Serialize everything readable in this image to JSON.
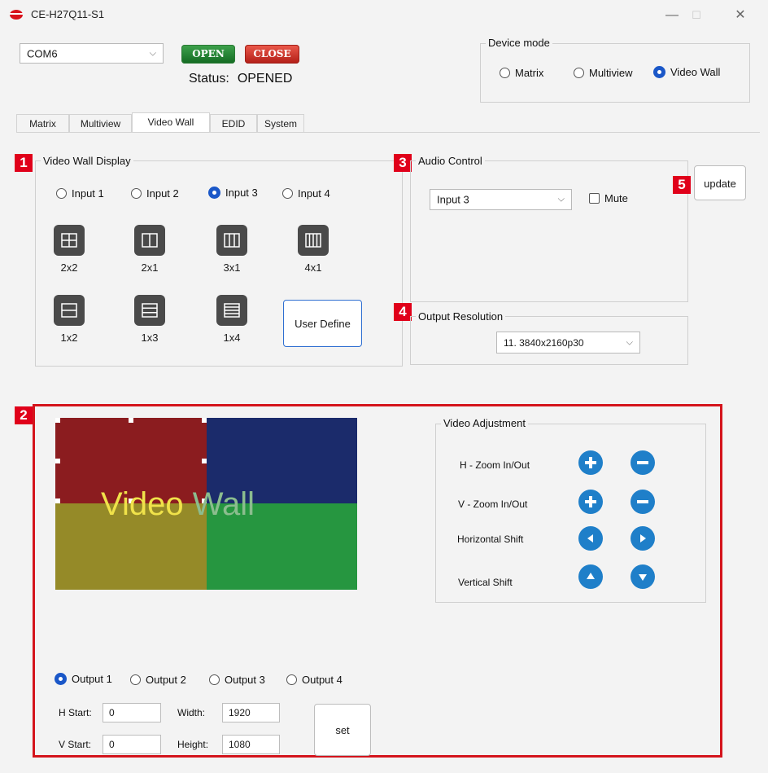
{
  "window": {
    "title": "CE-H27Q11-S1",
    "minimize_glyph": "—",
    "maximize_glyph": "☐",
    "close_glyph": "✕"
  },
  "connection": {
    "port_value": "COM6",
    "open_label": "OPEN",
    "close_label": "CLOSE",
    "status_label": "Status:",
    "status_value": "OPENED"
  },
  "device_mode": {
    "label": "Device mode",
    "options": [
      "Matrix",
      "Multiview",
      "Video Wall"
    ],
    "selected": "Video Wall"
  },
  "tabs": [
    "Matrix",
    "Multiview",
    "Video Wall",
    "EDID",
    "System"
  ],
  "active_tab": "Video Wall",
  "badges": [
    "1",
    "2",
    "3",
    "4",
    "5"
  ],
  "video_wall_display": {
    "label": "Video Wall Display",
    "inputs": [
      "Input 1",
      "Input 2",
      "Input 3",
      "Input 4"
    ],
    "selected_input": "Input 3",
    "layouts": [
      "2x2",
      "2x1",
      "3x1",
      "4x1",
      "1x2",
      "1x3",
      "1x4"
    ],
    "user_define_label": "User Define"
  },
  "audio_control": {
    "label": "Audio Control",
    "source_value": "Input 3",
    "mute_label": "Mute",
    "mute_checked": false
  },
  "update_label": "update",
  "output_resolution": {
    "label": "Output Resolution",
    "value": "11. 3840x2160p30"
  },
  "preview": {
    "text_part1": "Video",
    "text_part2": "Wall",
    "colors": {
      "top_left": "#8b1c1f",
      "top_right": "#1b2b6b",
      "bottom_left": "#958a28",
      "bottom_right": "#269640"
    }
  },
  "video_adjustment": {
    "label": "Video Adjustment",
    "rows": [
      "H - Zoom In/Out",
      "V - Zoom In/Out",
      "Horizontal Shift",
      "Vertical Shift"
    ]
  },
  "outputs": {
    "options": [
      "Output 1",
      "Output 2",
      "Output 3",
      "Output 4"
    ],
    "selected": "Output 1"
  },
  "position": {
    "h_start_label": "H Start:",
    "h_start_value": "0",
    "v_start_label": "V Start:",
    "v_start_value": "0",
    "width_label": "Width:",
    "width_value": "1920",
    "height_label": "Height:",
    "height_value": "1080",
    "set_label": "set"
  }
}
